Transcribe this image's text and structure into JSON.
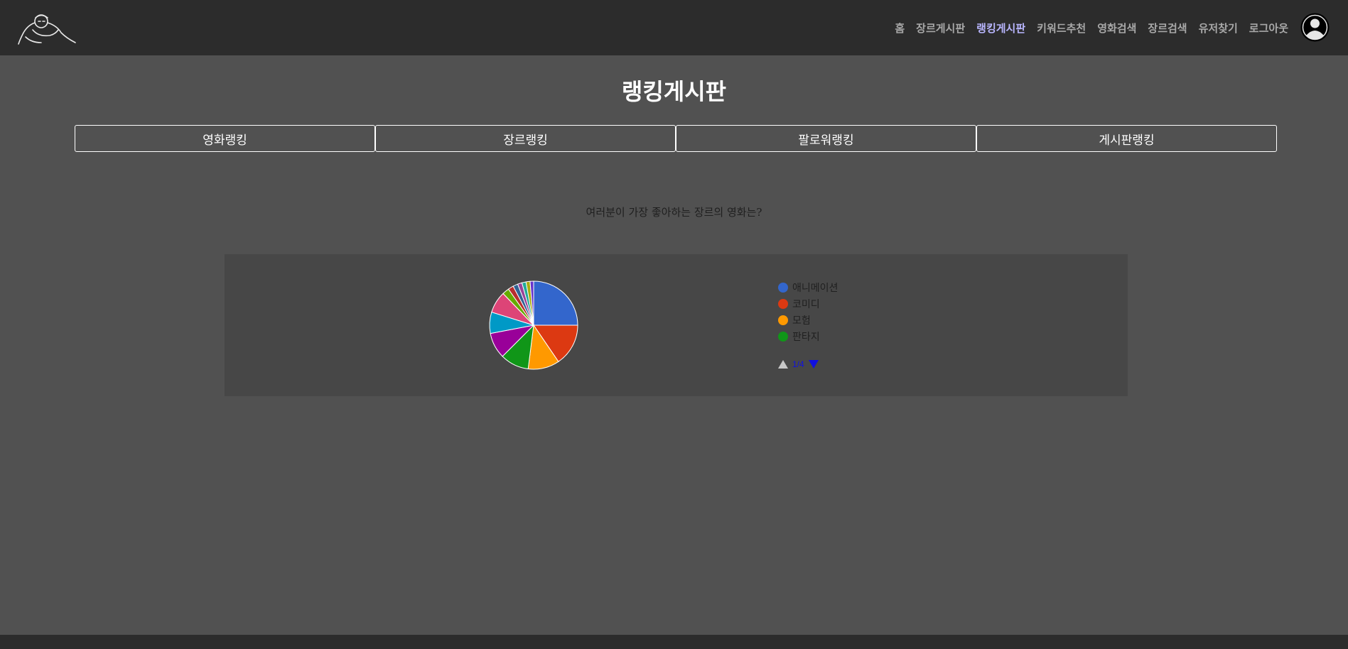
{
  "nav": {
    "links": [
      "홈",
      "장르게시판",
      "랭킹게시판",
      "키워드추천",
      "영화검색",
      "장르검색",
      "유저찾기",
      "로그아웃"
    ],
    "active_index": 2
  },
  "page": {
    "title": "랭킹게시판",
    "tabs": [
      "영화랭킹",
      "장르랭킹",
      "팔로워랭킹",
      "게시판랭킹"
    ],
    "question": "여러분이 가장 좋아하는 장르의 영화는?"
  },
  "legend": {
    "items": [
      {
        "label": "애니메이션",
        "color": "#3366cc"
      },
      {
        "label": "코미디",
        "color": "#dc3912"
      },
      {
        "label": "모험",
        "color": "#ff9900"
      },
      {
        "label": "판타지",
        "color": "#109618"
      }
    ],
    "page_indicator": "1/4"
  },
  "chart_data": {
    "type": "pie",
    "slices": [
      {
        "name": "애니메이션",
        "value": 25.0,
        "color": "#3366cc"
      },
      {
        "name": "코미디",
        "value": 15.5,
        "color": "#dc3912"
      },
      {
        "name": "모험",
        "value": 11.5,
        "color": "#ff9900"
      },
      {
        "name": "판타지",
        "value": 10.5,
        "color": "#109618"
      },
      {
        "name": "",
        "value": 9.5,
        "color": "#990099"
      },
      {
        "name": "",
        "value": 7.8,
        "color": "#0099c6"
      },
      {
        "name": "",
        "value": 8.0,
        "color": "#dd4477"
      },
      {
        "name": "",
        "value": 2.5,
        "color": "#66aa00"
      },
      {
        "name": "",
        "value": 2.0,
        "color": "#b82e2e"
      },
      {
        "name": "",
        "value": 1.8,
        "color": "#316395"
      },
      {
        "name": "",
        "value": 1.6,
        "color": "#994499"
      },
      {
        "name": "",
        "value": 1.5,
        "color": "#22aa99"
      },
      {
        "name": "",
        "value": 1.5,
        "color": "#aaaa11"
      },
      {
        "name": "",
        "value": 1.3,
        "color": "#6633cc"
      }
    ]
  }
}
